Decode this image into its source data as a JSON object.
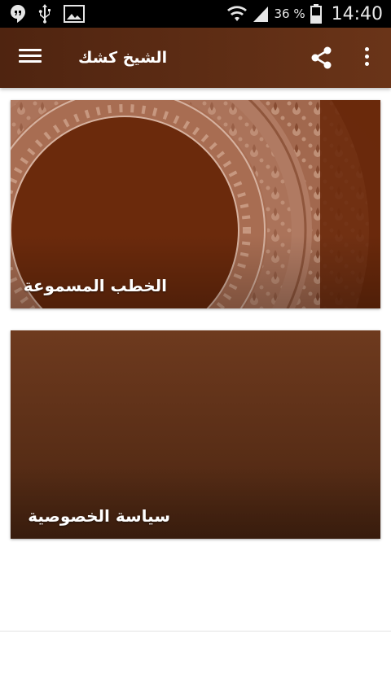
{
  "status_bar": {
    "left_icons": [
      "hangouts-icon",
      "usb-icon",
      "image-icon"
    ],
    "right_icons": [
      "wifi-icon",
      "signal-icon",
      "battery-icon"
    ],
    "battery_percent": "36 %",
    "time": "14:40"
  },
  "toolbar": {
    "title": "الشيخ كشك",
    "menu_icon": "hamburger-menu-icon",
    "share_icon": "share-icon",
    "overflow_icon": "more-vert-icon"
  },
  "cards": [
    {
      "label": "الخطب المسموعة"
    },
    {
      "label": "سياسة الخصوصية"
    }
  ],
  "colors": {
    "toolbar": "#5a2b14",
    "card_brown": "#6b2a0c",
    "status_bar": "#000000"
  }
}
